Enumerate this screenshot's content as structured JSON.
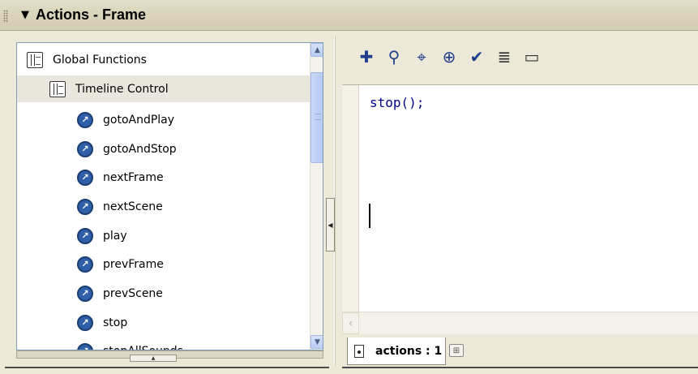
{
  "window": {
    "title": "Actions - Frame",
    "collapse_glyph": "▼"
  },
  "tree": {
    "items": [
      {
        "label": "Global Functions",
        "icon": "book-icon",
        "level": 0,
        "selected": false
      },
      {
        "label": "Timeline Control",
        "icon": "book-icon",
        "level": 1,
        "selected": true
      },
      {
        "label": "gotoAndPlay",
        "icon": "action-icon",
        "level": 2,
        "selected": false
      },
      {
        "label": "gotoAndStop",
        "icon": "action-icon",
        "level": 2,
        "selected": false
      },
      {
        "label": "nextFrame",
        "icon": "action-icon",
        "level": 2,
        "selected": false
      },
      {
        "label": "nextScene",
        "icon": "action-icon",
        "level": 2,
        "selected": false
      },
      {
        "label": "play",
        "icon": "action-icon",
        "level": 2,
        "selected": false
      },
      {
        "label": "prevFrame",
        "icon": "action-icon",
        "level": 2,
        "selected": false
      },
      {
        "label": "prevScene",
        "icon": "action-icon",
        "level": 2,
        "selected": false
      },
      {
        "label": "stop",
        "icon": "action-icon",
        "level": 2,
        "selected": false
      },
      {
        "label": "stopAllSounds",
        "icon": "action-icon",
        "level": 2,
        "selected": false
      }
    ]
  },
  "toolbar": {
    "icons": [
      {
        "name": "add-item-icon",
        "glyph": "✚"
      },
      {
        "name": "find-icon",
        "glyph": "⚲"
      },
      {
        "name": "insert-target-path-icon",
        "glyph": "⌖"
      },
      {
        "name": "target-icon",
        "glyph": "⊕"
      },
      {
        "name": "check-syntax-icon",
        "glyph": "✔"
      },
      {
        "name": "auto-format-icon",
        "glyph": "≣"
      },
      {
        "name": "code-hint-icon",
        "glyph": "▭"
      }
    ]
  },
  "editor": {
    "code": "stop();"
  },
  "tabs": {
    "active_label": "actions : 1"
  },
  "colors": {
    "panel_bg": "#ece9d8",
    "code_color": "#00008b",
    "icon_blue": "#2f5fa8"
  }
}
